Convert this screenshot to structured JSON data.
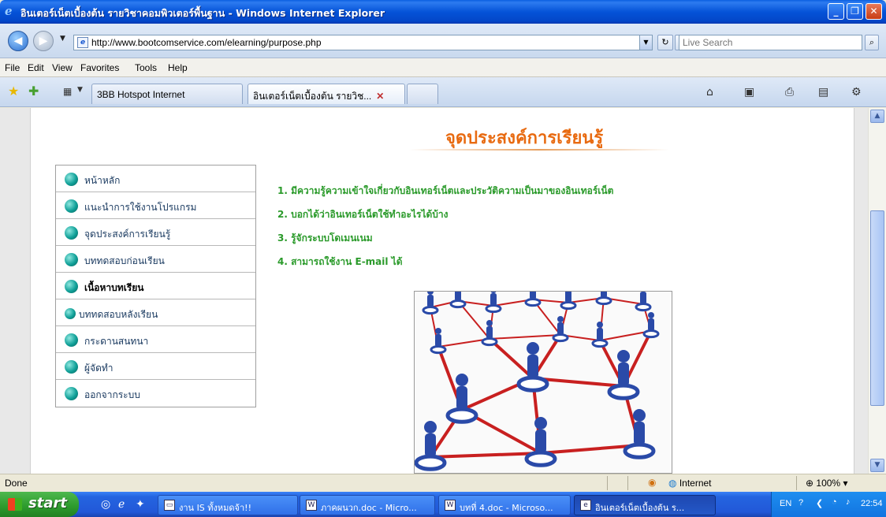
{
  "window": {
    "title": "อินเตอร์เน็ตเบื้องต้น รายวิชาคอมพิวเตอร์พื้นฐาน - Windows Internet Explorer",
    "minimize": "_",
    "maximize": "❐",
    "close": "✕"
  },
  "address": {
    "url": "http://www.bootcomservice.com/elearning/purpose.php",
    "search_placeholder": "Live Search"
  },
  "menu": [
    "File",
    "Edit",
    "View",
    "Favorites",
    "Tools",
    "Help"
  ],
  "tabs": [
    {
      "label": "3BB Hotspot Internet"
    },
    {
      "label": "อินเตอร์เน็ตเบื้องต้น รายวิช..."
    }
  ],
  "page": {
    "heading": "จุดประสงค์การเรียนรู้",
    "nav": [
      "หน้าหลัก",
      "แนะนำการใช้งานโปรแกรม",
      "จุดประสงค์การเรียนรู้",
      "บททดสอบก่อนเรียน",
      "เนื้อหาบทเรียน",
      "บททดสอบหลังเรียน",
      "กระดานสนทนา",
      "ผู้จัดทำ",
      "ออกจากระบบ"
    ],
    "objectives": [
      "1. มีความรู้ความเข้าใจเกี่ยวกับอินเทอร์เน็ตและประวัติความเป็นมาของอินเทอร์เน็ต",
      "2. บอกได้ว่าอินเทอร์เน็ตใช้ทำอะไรได้บ้าง",
      "3. รู้จักระบบโดเมนเนม",
      "4. สามารถใช้งาน E-mail ได้"
    ]
  },
  "status": {
    "text": "Done",
    "zone": "Internet",
    "zoom": "100%"
  },
  "taskbar": {
    "start": "start",
    "tasks": [
      "งาน IS ทั้งหมดจ้า!!",
      "ภาคผนวก.doc - Micro...",
      "บทที่ 4.doc - Microso...",
      "อินเตอร์เน็ตเบื้องต้น ร..."
    ],
    "lang": "EN",
    "clock": "22:54"
  },
  "colors": {
    "heading": "#e86a10",
    "objective_text": "#2a9a2a",
    "nav_bullet": "#10a098",
    "network_line": "#c82020",
    "network_person": "#2a4aa8"
  }
}
